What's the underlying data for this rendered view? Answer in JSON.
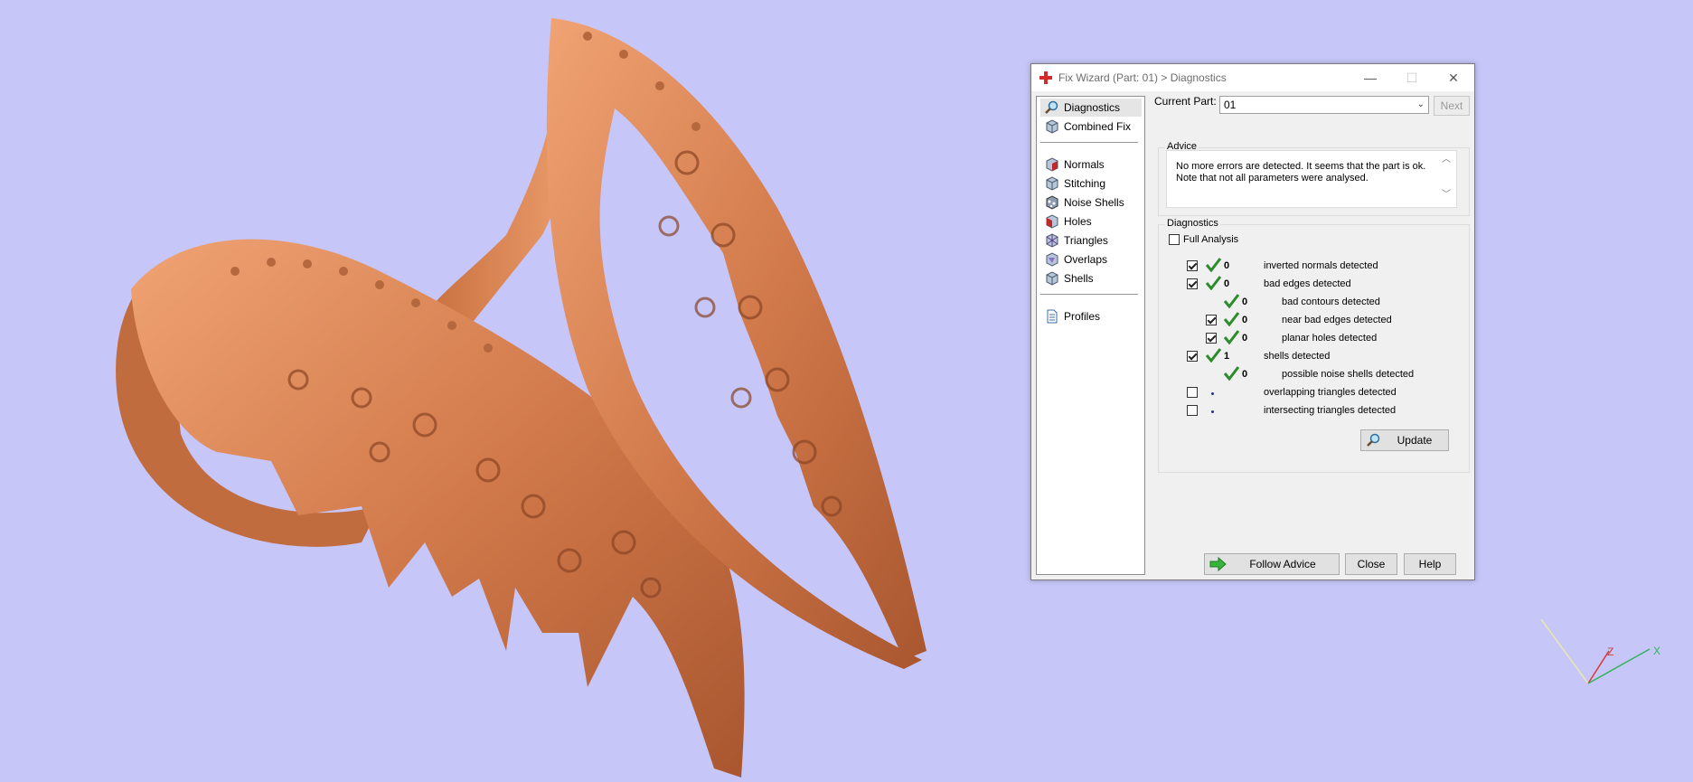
{
  "dialog": {
    "title": "Fix Wizard (Part: 01) > Diagnostics",
    "window_controls": {
      "minimize": "—",
      "maximize": "☐",
      "close": "✕"
    }
  },
  "nav": {
    "items": [
      {
        "label": "Diagnostics",
        "icon": "magnifier-icon"
      },
      {
        "label": "Combined Fix",
        "icon": "cube-icon"
      },
      {
        "label": "Normals",
        "icon": "normals-cube-icon"
      },
      {
        "label": "Stitching",
        "icon": "stitching-cube-icon"
      },
      {
        "label": "Noise Shells",
        "icon": "noise-shells-icon"
      },
      {
        "label": "Holes",
        "icon": "holes-cube-icon"
      },
      {
        "label": "Triangles",
        "icon": "triangles-icon"
      },
      {
        "label": "Overlaps",
        "icon": "overlaps-icon"
      },
      {
        "label": "Shells",
        "icon": "shells-icon"
      },
      {
        "label": "Profiles",
        "icon": "profiles-document-icon"
      }
    ]
  },
  "part": {
    "label": "Current Part:",
    "value": "01",
    "next_label": "Next"
  },
  "advice": {
    "legend": "Advice",
    "text_line1": "No more errors are detected. It seems that the part is ok.",
    "text_line2": "Note that not all parameters were analysed."
  },
  "diagnostics": {
    "legend": "Diagnostics",
    "full_analysis_label": "Full Analysis",
    "rows": [
      {
        "checked": true,
        "status": "ok",
        "count": "0",
        "label": "inverted normals detected"
      },
      {
        "checked": true,
        "status": "ok",
        "count": "0",
        "label": "bad edges detected"
      },
      {
        "checked": null,
        "status": "ok",
        "count": "0",
        "label": "bad contours detected"
      },
      {
        "checked": true,
        "status": "ok",
        "count": "0",
        "label": "near bad edges detected"
      },
      {
        "checked": true,
        "status": "ok",
        "count": "0",
        "label": "planar holes detected"
      },
      {
        "checked": true,
        "status": "ok",
        "count": "1",
        "label": "shells detected"
      },
      {
        "checked": null,
        "status": "ok",
        "count": "0",
        "label": "possible noise shells detected"
      },
      {
        "checked": false,
        "status": "pending",
        "count": "",
        "label": "overlapping triangles detected"
      },
      {
        "checked": false,
        "status": "pending",
        "count": "",
        "label": "intersecting triangles detected"
      }
    ],
    "update_label": "Update"
  },
  "footer": {
    "follow_advice_label": "Follow Advice",
    "close_label": "Close",
    "help_label": "Help"
  },
  "axes": {
    "z_label": "Z",
    "x_label": "X"
  },
  "colors": {
    "viewport_bg": "#c6c6f9",
    "model": "#d9875a",
    "check_green": "#2e8b2e"
  }
}
